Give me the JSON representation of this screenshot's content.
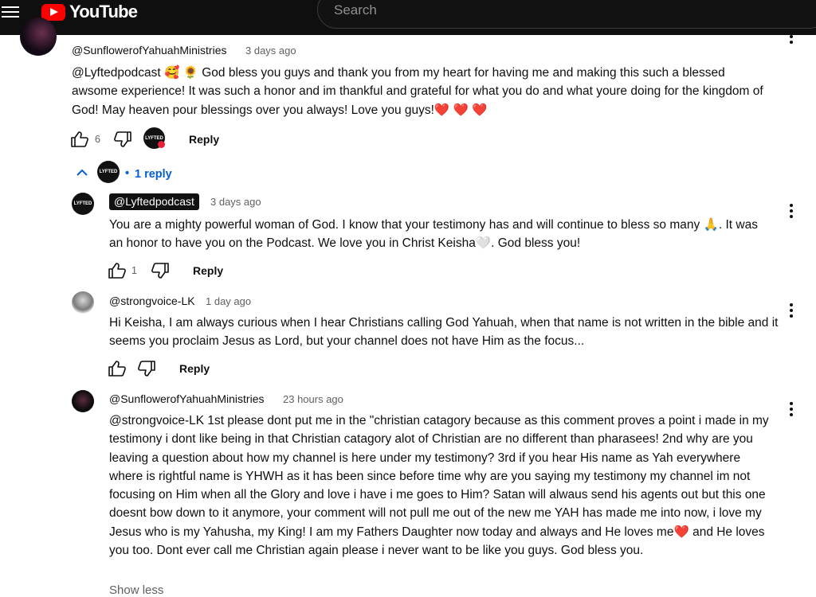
{
  "header": {
    "logo_text": "YouTube",
    "search_placeholder": "Search"
  },
  "comment": {
    "author": "@SunflowerofYahuahMinistries",
    "time": "3 days ago",
    "text_parts": [
      "@Lyftedpodcast ",
      " God bless you guys and thank you from my heart for having me and making this such a blessed awsome experience! It was such a honor and im thankful and grateful for what you do and what youre doing for the kingdom of God! May heaven pour blessings over you always! Love you guys!"
    ],
    "emojis": [
      "🥰",
      "🌻",
      "❤️",
      "❤️",
      "❤️"
    ],
    "likes": "6",
    "reply_label": "Reply",
    "creator_avatar_text": "LYFTED"
  },
  "replies_toggle": {
    "bullet": "•",
    "label": "1 reply"
  },
  "replies": [
    {
      "author": "@Lyftedpodcast",
      "time": "3 days ago",
      "text_parts": [
        "You are a mighty powerful woman of God. I know that your testimony has and will continue to bless so many ",
        ". It was an honor to have you on the Podcast. We love you in Christ Keisha",
        ". God bless you!"
      ],
      "emojis": [
        "🙏",
        "🤍"
      ],
      "likes": "1",
      "reply_label": "Reply",
      "avatar_text": "LYFTED"
    },
    {
      "author": "@strongvoice-LK",
      "time": "1 day ago",
      "text": "Hi Keisha, I am always curious when I hear Christians calling God Yahuah, when that name is not written in the bible and it seems you proclaim Jesus as Lord, but your channel does not have Him as the focus...",
      "reply_label": "Reply"
    },
    {
      "author": "@SunflowerofYahuahMinistries",
      "time": "23 hours ago",
      "text_parts": [
        "@strongvoice-LK 1st please dont put me in the \"christian catagory because as this comment proves a point i made in my testimony i dont like being in that Christian catagory alot of Christian are no different than pharasees! 2nd why are you leaving a question about how my channel is here under my testimony? 3rd if you hear His name as Yah everywhere where is rightful name is YHWH as it has been since before time why are you saying my testimony my channel im not focusing on Him when all the Glory and love i have i me goes to Him? Satan will alwaus send his agents out but this one doesnt bow down to it anymore, your comment will not pull me out of the new me YAH has made me into now, i love my Jesus who is my Yahusha,  my King! I am my Fathers Daughter now today and always and He loves me",
        " and He loves you too. Dont ever call me Christian again please i never want to be like you guys. God bless you."
      ],
      "emojis": [
        "❤️"
      ],
      "show_less": "Show less"
    }
  ],
  "colors": {
    "accent_blue": "#065fd4",
    "topbar": "#0f0f0f",
    "brand_red": "#ff0000",
    "meta_gray": "#606060"
  }
}
